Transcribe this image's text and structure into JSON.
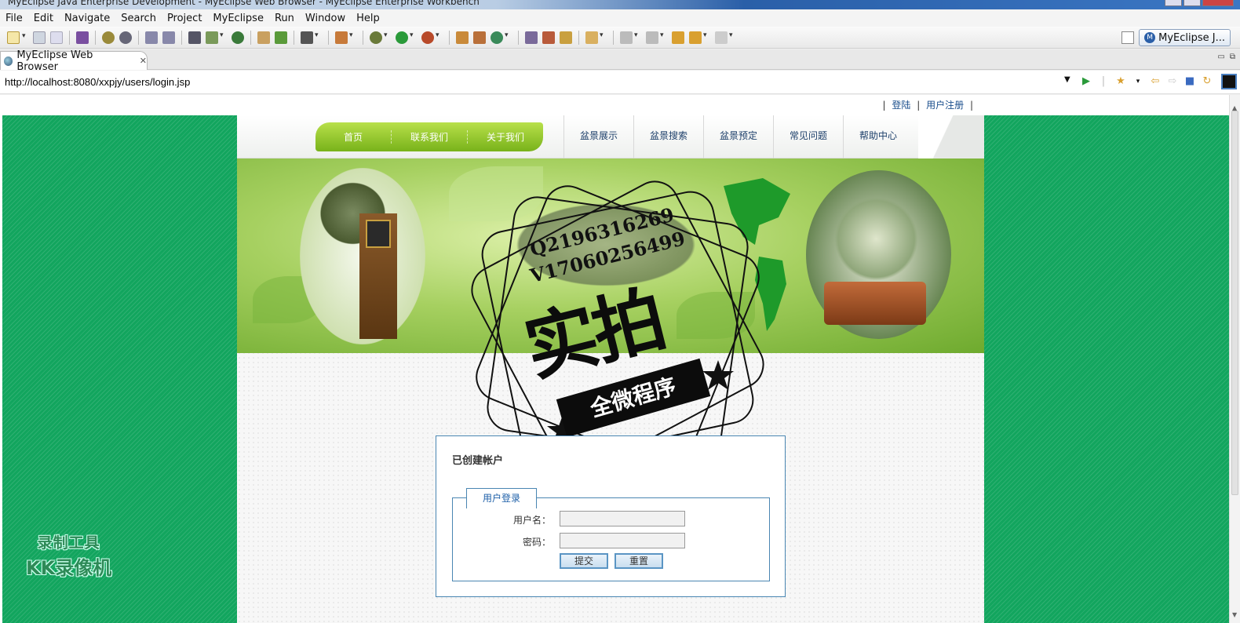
{
  "window": {
    "title": "MyEclipse Java Enterprise Development - MyEclipse Web Browser - MyEclipse Enterprise Workbench"
  },
  "menu": [
    "File",
    "Edit",
    "Navigate",
    "Search",
    "Project",
    "MyEclipse",
    "Run",
    "Window",
    "Help"
  ],
  "perspective": {
    "label": "MyEclipse J...",
    "icon": "myeclipse-perspective-icon"
  },
  "editor_tab": {
    "label": "MyEclipse Web Browser",
    "close": "✕"
  },
  "browser": {
    "url": "http://localhost:8080/xxpjy/users/login.jsp"
  },
  "page": {
    "top_links": {
      "sep": "|",
      "login": "登陆",
      "register": "用户注册"
    },
    "nav_green": [
      "首页",
      "联系我们",
      "关于我们"
    ],
    "nav_gray": [
      "盆景展示",
      "盆景搜索",
      "盆景预定",
      "常见问题",
      "帮助中心"
    ],
    "login_box": {
      "heading": "已创建帐户",
      "legend": "用户登录",
      "username_label": "用户名：",
      "password_label": "密码：",
      "username_value": "",
      "password_value": "",
      "submit_label": "提交",
      "reset_label": "重置"
    }
  },
  "overlay_watermark": {
    "line1": "Q2196316269",
    "line2": "V17060256499",
    "big": "实拍",
    "ribbon": "全微程序"
  },
  "recorder_watermark": {
    "line1": "录制工具",
    "line2": "KK录像机"
  },
  "colors": {
    "side_green": "#12a55e",
    "nav_green": "#8cc63f",
    "login_border": "#4a86b2"
  }
}
